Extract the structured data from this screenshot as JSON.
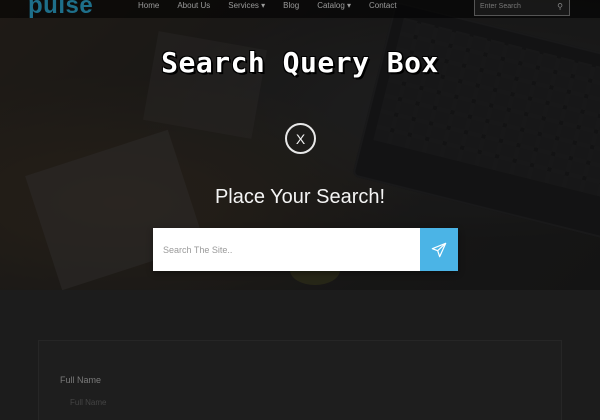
{
  "brand": {
    "logo_text": "pulse",
    "logo_color": "#1e6f8a"
  },
  "nav": {
    "items": [
      "Home",
      "About Us",
      "Services ▾",
      "Blog",
      "Catalog ▾",
      "Contact"
    ],
    "search_placeholder": "Enter Search"
  },
  "banner": {
    "title": "Search Query Box"
  },
  "modal": {
    "close_label": "X",
    "heading": "Place Your Search!",
    "search_placeholder": "Search The Site..",
    "submit_icon": "paper-plane-icon",
    "accent_color": "#4bb4e6"
  },
  "form": {
    "full_name_label": "Full Name",
    "full_name_placeholder": "Full Name"
  }
}
